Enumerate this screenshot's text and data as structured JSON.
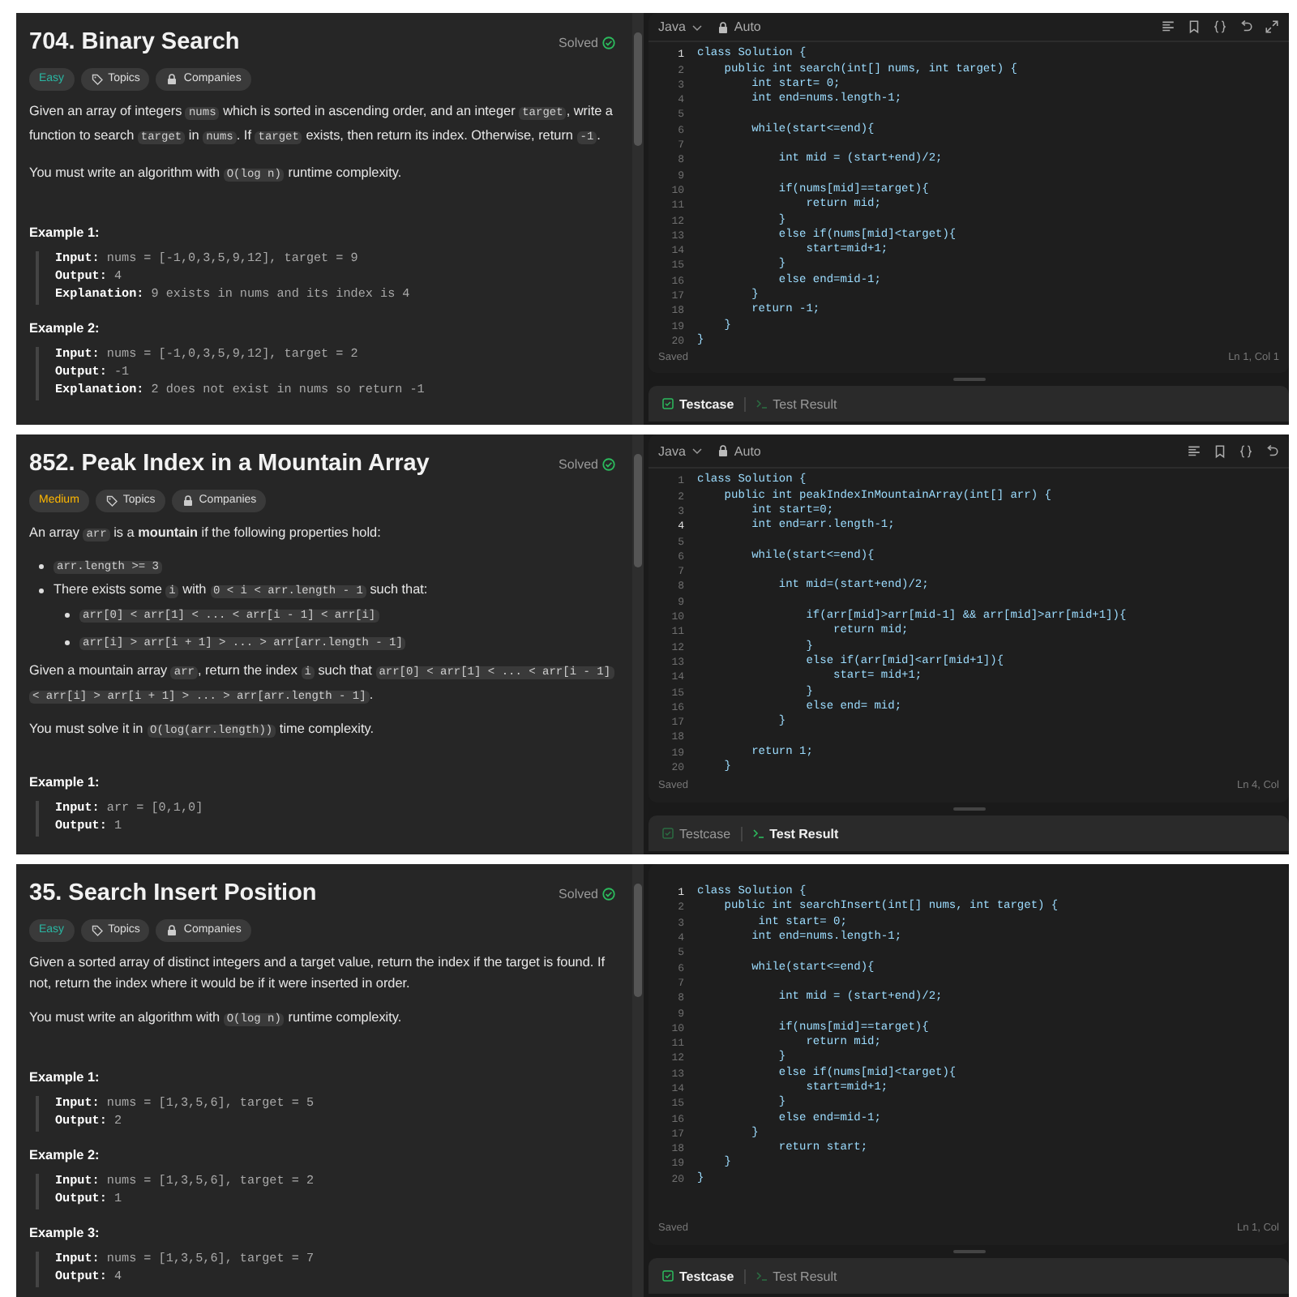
{
  "panels": [
    {
      "problem": {
        "title": "704. Binary Search",
        "solved": "Solved",
        "difficulty": {
          "label": "Easy",
          "kind": "easy"
        },
        "tags": [
          {
            "label": "Topics",
            "kind": "topics"
          },
          {
            "label": "Companies",
            "kind": "companies"
          }
        ],
        "description": [
          {
            "kind": "para",
            "segments": [
              {
                "kind": "text",
                "text": "Given an array of integers "
              },
              {
                "kind": "code",
                "text": "nums"
              },
              {
                "kind": "text",
                "text": " which is sorted in ascending order, and an integer "
              },
              {
                "kind": "code",
                "text": "target"
              },
              {
                "kind": "text",
                "text": ", write a function to search "
              },
              {
                "kind": "code",
                "text": "target"
              },
              {
                "kind": "text",
                "text": " in "
              },
              {
                "kind": "code",
                "text": "nums"
              },
              {
                "kind": "text",
                "text": ". If "
              },
              {
                "kind": "code",
                "text": "target"
              },
              {
                "kind": "text",
                "text": " exists, then return its index. Otherwise, return "
              },
              {
                "kind": "code",
                "text": "-1"
              },
              {
                "kind": "text",
                "text": "."
              }
            ]
          },
          {
            "kind": "para",
            "segments": [
              {
                "kind": "text",
                "text": "You must write an algorithm with "
              },
              {
                "kind": "code",
                "text": "O(log n)"
              },
              {
                "kind": "text",
                "text": " runtime complexity."
              }
            ]
          }
        ],
        "examples": [
          {
            "heading": "Example 1:",
            "lines": [
              {
                "label": "Input:",
                "value": "nums = [-1,0,3,5,9,12], target = 9"
              },
              {
                "label": "Output:",
                "value": "4"
              },
              {
                "label": "Explanation:",
                "value": "9 exists in nums and its index is 4"
              }
            ]
          },
          {
            "heading": "Example 2:",
            "lines": [
              {
                "label": "Input:",
                "value": "nums = [-1,0,3,5,9,12], target = 2"
              },
              {
                "label": "Output:",
                "value": "-1"
              },
              {
                "label": "Explanation:",
                "value": "2 does not exist in nums so return -1"
              }
            ]
          }
        ]
      },
      "editor": {
        "header": {
          "language": "Java",
          "mode": "Auto",
          "tools": [
            {
              "kind": "format"
            },
            {
              "kind": "bookmark"
            },
            {
              "kind": "braces"
            },
            {
              "kind": "undo"
            },
            {
              "kind": "expand"
            }
          ]
        },
        "lines": [
          {
            "n": "1",
            "current": true,
            "text": "class Solution {"
          },
          {
            "n": "2",
            "current": false,
            "text": "    public int search(int[] nums, int target) {"
          },
          {
            "n": "3",
            "current": false,
            "text": "        int start= 0;"
          },
          {
            "n": "4",
            "current": false,
            "text": "        int end=nums.length-1;"
          },
          {
            "n": "5",
            "current": false
          },
          {
            "n": "6",
            "current": false,
            "text": "        while(start<=end){"
          },
          {
            "n": "7",
            "current": false
          },
          {
            "n": "8",
            "current": false,
            "text": "            int mid = (start+end)/2;"
          },
          {
            "n": "9",
            "current": false
          },
          {
            "n": "10",
            "current": false,
            "text": "            if(nums[mid]==target){"
          },
          {
            "n": "11",
            "current": false,
            "text": "                return mid;"
          },
          {
            "n": "12",
            "current": false,
            "text": "            }"
          },
          {
            "n": "13",
            "current": false,
            "text": "            else if(nums[mid]<target){"
          },
          {
            "n": "14",
            "current": false,
            "text": "                start=mid+1;"
          },
          {
            "n": "15",
            "current": false,
            "text": "            }"
          },
          {
            "n": "16",
            "current": false,
            "text": "            else end=mid-1;"
          },
          {
            "n": "17",
            "current": false,
            "text": "        }"
          },
          {
            "n": "18",
            "current": false,
            "text": "        return -1;"
          },
          {
            "n": "19",
            "current": false,
            "text": "    }"
          },
          {
            "n": "20",
            "current": false,
            "text": "}"
          }
        ],
        "saved": "Saved",
        "cursor": "Ln 1, Col 1",
        "tabs": [
          {
            "label": "Testcase",
            "kind": "testcase",
            "selected": true
          },
          {
            "label": "Test Result",
            "kind": "result",
            "selected": false
          }
        ]
      }
    },
    {
      "problem": {
        "title": "852. Peak Index in a Mountain Array",
        "solved": "Solved",
        "difficulty": {
          "label": "Medium",
          "kind": "medium"
        },
        "tags": [
          {
            "label": "Topics",
            "kind": "topics"
          },
          {
            "label": "Companies",
            "kind": "companies"
          }
        ],
        "description": [
          {
            "kind": "para",
            "segments": [
              {
                "kind": "text",
                "text": "An array "
              },
              {
                "kind": "code",
                "text": "arr"
              },
              {
                "kind": "text",
                "text": " is a **mountain** if the following properties hold:"
              }
            ]
          },
          {
            "kind": "list",
            "items": [
              {
                "segments": [
                  {
                    "kind": "code",
                    "text": "arr.length >= 3"
                  }
                ]
              },
              {
                "segments": [
                  {
                    "kind": "text",
                    "text": "There exists some "
                  },
                  {
                    "kind": "code",
                    "text": "i"
                  },
                  {
                    "kind": "text",
                    "text": " with "
                  },
                  {
                    "kind": "code",
                    "text": "0 < i < arr.length - 1"
                  },
                  {
                    "kind": "text",
                    "text": " such that:"
                  }
                ],
                "children": [
                  {
                    "segments": [
                      {
                        "kind": "code",
                        "text": "arr[0] < arr[1] < ... < arr[i - 1] < arr[i]"
                      }
                    ]
                  },
                  {
                    "segments": [
                      {
                        "kind": "code",
                        "text": "arr[i] > arr[i + 1] > ... > arr[arr.length - 1]"
                      }
                    ]
                  }
                ]
              }
            ]
          },
          {
            "kind": "para",
            "segments": [
              {
                "kind": "text",
                "text": "Given a mountain array "
              },
              {
                "kind": "code",
                "text": "arr"
              },
              {
                "kind": "text",
                "text": ", return the index "
              },
              {
                "kind": "code",
                "text": "i"
              },
              {
                "kind": "text",
                "text": " such that "
              },
              {
                "kind": "code",
                "text": "arr[0] < arr[1] < ... < arr[i - 1] < arr[i] > arr[i + 1] > ... > arr[arr.length - 1]"
              },
              {
                "kind": "text",
                "text": "."
              }
            ]
          },
          {
            "kind": "para",
            "segments": [
              {
                "kind": "text",
                "text": "You must solve it in "
              },
              {
                "kind": "code",
                "text": "O(log(arr.length))"
              },
              {
                "kind": "text",
                "text": " time complexity."
              }
            ]
          }
        ],
        "examples": [
          {
            "heading": "Example 1:",
            "lines": [
              {
                "label": "Input:",
                "value": "arr = [0,1,0]"
              },
              {
                "label": "Output:",
                "value": "1"
              }
            ]
          }
        ]
      },
      "editor": {
        "header": {
          "language": "Java",
          "mode": "Auto",
          "tools": [
            {
              "kind": "format"
            },
            {
              "kind": "bookmark"
            },
            {
              "kind": "braces"
            },
            {
              "kind": "undo"
            }
          ]
        },
        "lines": [
          {
            "n": "1",
            "current": false,
            "text": "class Solution {"
          },
          {
            "n": "2",
            "current": false,
            "text": "    public int peakIndexInMountainArray(int[] arr) {"
          },
          {
            "n": "3",
            "current": false,
            "text": "        int start=0;"
          },
          {
            "n": "4",
            "current": true,
            "text": "        int end=arr.length-1;"
          },
          {
            "n": "5",
            "current": false
          },
          {
            "n": "6",
            "current": false,
            "text": "        while(start<=end){"
          },
          {
            "n": "7",
            "current": false
          },
          {
            "n": "8",
            "current": false,
            "text": "            int mid=(start+end)/2;"
          },
          {
            "n": "9",
            "current": false
          },
          {
            "n": "10",
            "current": false,
            "text": "                if(arr[mid]>arr[mid-1] && arr[mid]>arr[mid+1]){"
          },
          {
            "n": "11",
            "current": false,
            "text": "                    return mid;"
          },
          {
            "n": "12",
            "current": false,
            "text": "                }"
          },
          {
            "n": "13",
            "current": false,
            "text": "                else if(arr[mid]<arr[mid+1]){"
          },
          {
            "n": "14",
            "current": false,
            "text": "                    start= mid+1;"
          },
          {
            "n": "15",
            "current": false,
            "text": "                }"
          },
          {
            "n": "16",
            "current": false,
            "text": "                else end= mid;"
          },
          {
            "n": "17",
            "current": false,
            "text": "            }"
          },
          {
            "n": "18",
            "current": false
          },
          {
            "n": "19",
            "current": false,
            "text": "        return 1;"
          },
          {
            "n": "20",
            "current": false,
            "text": "    }"
          }
        ],
        "saved": "Saved",
        "cursor": "Ln 4, Col",
        "tabs": [
          {
            "label": "Testcase",
            "kind": "testcase",
            "selected": false
          },
          {
            "label": "Test Result",
            "kind": "result",
            "selected": true
          }
        ]
      }
    },
    {
      "problem": {
        "title": "35. Search Insert Position",
        "solved": "Solved",
        "difficulty": {
          "label": "Easy",
          "kind": "easy"
        },
        "tags": [
          {
            "label": "Topics",
            "kind": "topics"
          },
          {
            "label": "Companies",
            "kind": "companies"
          }
        ],
        "description": [
          {
            "kind": "para",
            "segments": [
              {
                "kind": "text",
                "text": "Given a sorted array of distinct integers and a target value, return the index if the target is found. If not, return the index where it would be if it were inserted in order."
              }
            ]
          },
          {
            "kind": "para",
            "segments": [
              {
                "kind": "text",
                "text": "You must write an algorithm with "
              },
              {
                "kind": "code",
                "text": "O(log n)"
              },
              {
                "kind": "text",
                "text": " runtime complexity."
              }
            ]
          }
        ],
        "examples": [
          {
            "heading": "Example 1:",
            "lines": [
              {
                "label": "Input:",
                "value": "nums = [1,3,5,6], target = 5"
              },
              {
                "label": "Output:",
                "value": "2"
              }
            ]
          },
          {
            "heading": "Example 2:",
            "lines": [
              {
                "label": "Input:",
                "value": "nums = [1,3,5,6], target = 2"
              },
              {
                "label": "Output:",
                "value": "1"
              }
            ]
          },
          {
            "heading": "Example 3:",
            "lines": [
              {
                "label": "Input:",
                "value": "nums = [1,3,5,6], target = 7"
              },
              {
                "label": "Output:",
                "value": "4"
              }
            ]
          }
        ]
      },
      "editor": {
        "lines": [
          {
            "n": "1",
            "current": true,
            "text": "class Solution {"
          },
          {
            "n": "2",
            "current": false,
            "text": "    public int searchInsert(int[] nums, int target) {"
          },
          {
            "n": "3",
            "current": false,
            "text": "         int start= 0;"
          },
          {
            "n": "4",
            "current": false,
            "text": "        int end=nums.length-1;"
          },
          {
            "n": "5",
            "current": false
          },
          {
            "n": "6",
            "current": false,
            "text": "        while(start<=end){"
          },
          {
            "n": "7",
            "current": false
          },
          {
            "n": "8",
            "current": false,
            "text": "            int mid = (start+end)/2;"
          },
          {
            "n": "9",
            "current": false
          },
          {
            "n": "10",
            "current": false,
            "text": "            if(nums[mid]==target){"
          },
          {
            "n": "11",
            "current": false,
            "text": "                return mid;"
          },
          {
            "n": "12",
            "current": false,
            "text": "            }"
          },
          {
            "n": "13",
            "current": false,
            "text": "            else if(nums[mid]<target){"
          },
          {
            "n": "14",
            "current": false,
            "text": "                start=mid+1;"
          },
          {
            "n": "15",
            "current": false,
            "text": "            }"
          },
          {
            "n": "16",
            "current": false,
            "text": "            else end=mid-1;"
          },
          {
            "n": "17",
            "current": false,
            "text": "        }"
          },
          {
            "n": "18",
            "current": false,
            "text": "            return start;"
          },
          {
            "n": "19",
            "current": false,
            "text": "    }"
          },
          {
            "n": "20",
            "current": false,
            "text": "}"
          }
        ],
        "saved": "Saved",
        "cursor": "Ln 1, Col",
        "tabs": [
          {
            "label": "Testcase",
            "kind": "testcase",
            "selected": true
          },
          {
            "label": "Test Result",
            "kind": "result",
            "selected": false
          }
        ]
      }
    }
  ]
}
